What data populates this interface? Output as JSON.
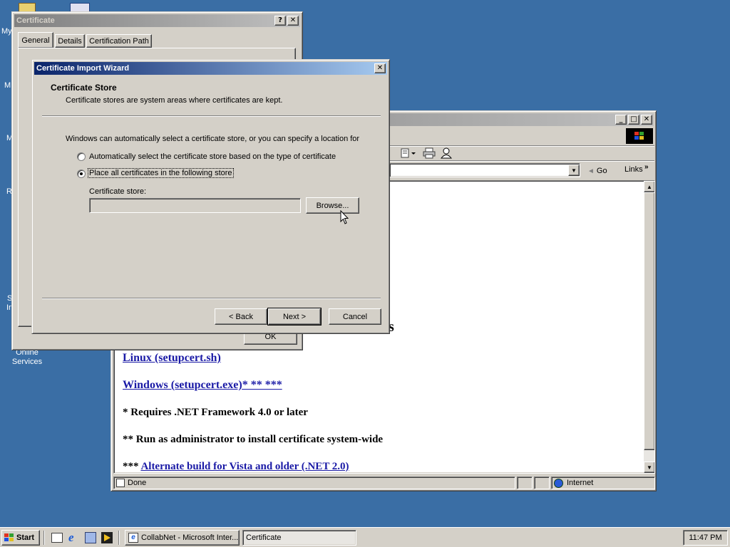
{
  "desktop": {
    "labels": [
      "My",
      "M",
      "M",
      "R",
      "S",
      "In"
    ],
    "online_services": "Online Services"
  },
  "ie_window": {
    "go_label": "Go",
    "links_label": "Links",
    "content": {
      "partial_heading": "s",
      "linux_link": "Linux (setupcert.sh)",
      "windows_link": "Windows (setupcert.exe)",
      "windows_suffix": "* ** ***",
      "note1": "* Requires .NET Framework 4.0 or later",
      "note2": "** Run as administrator to install certificate system-wide",
      "note3_prefix": "***",
      "note3_link": "Alternate build for Vista and older (.NET 2.0)"
    },
    "status": {
      "text": "Done",
      "zone": "Internet"
    }
  },
  "cert_window": {
    "title": "Certificate",
    "tabs": [
      "General",
      "Details",
      "Certification Path"
    ],
    "ok_label": "OK"
  },
  "wizard": {
    "title": "Certificate Import Wizard",
    "header_title": "Certificate Store",
    "header_desc": "Certificate stores are system areas where certificates are kept.",
    "intro": "Windows can automatically select a certificate store, or you can specify a location for",
    "option_auto": "Automatically select the certificate store based on the type of certificate",
    "option_manual": "Place all certificates in the following store",
    "store_label": "Certificate store:",
    "store_value": "",
    "browse_label": "Browse...",
    "back_label": "< Back",
    "next_label": "Next >",
    "cancel_label": "Cancel"
  },
  "taskbar": {
    "start_label": "Start",
    "tasks": [
      {
        "label": "CollabNet - Microsoft Inter...",
        "active": false
      },
      {
        "label": "Certificate",
        "active": true
      }
    ],
    "clock": "11:47 PM"
  },
  "colors": {
    "desktop": "#3a6ea5",
    "face": "#d4d0c8",
    "active_title": "#0a246a",
    "link": "#1a1aa6"
  }
}
